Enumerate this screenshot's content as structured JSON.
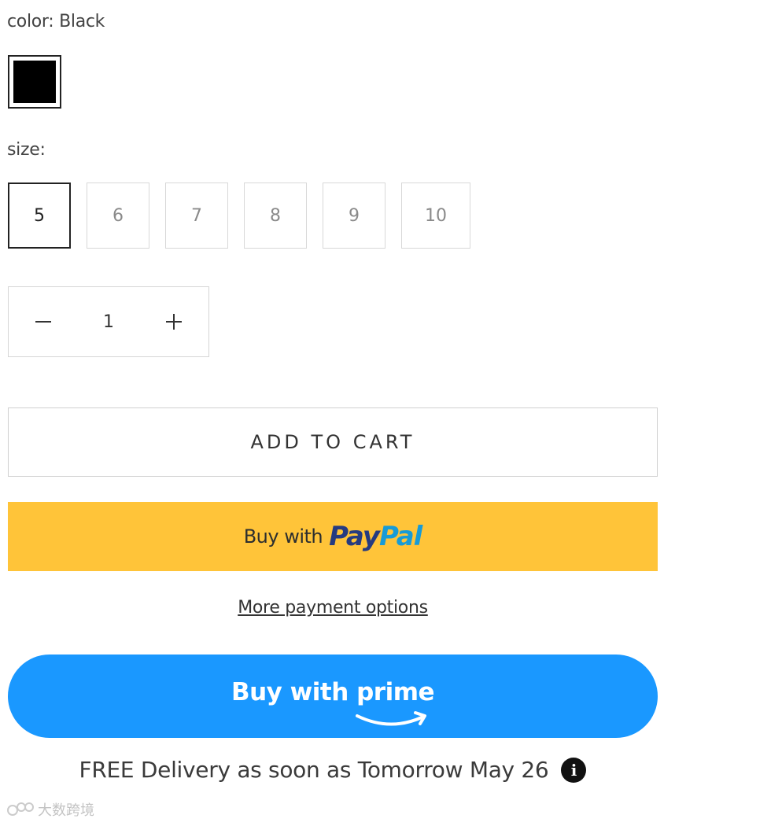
{
  "color": {
    "label": "color: Black",
    "swatch_color": "#000000"
  },
  "size": {
    "label": "size:",
    "options": [
      "5",
      "6",
      "7",
      "8",
      "9",
      "10"
    ],
    "selected": "5"
  },
  "quantity": {
    "value": "1",
    "minus_icon": "minus-icon",
    "plus_icon": "plus-icon"
  },
  "buttons": {
    "add_to_cart": "ADD TO CART",
    "paypal_buy": "Buy with",
    "paypal_brand_pay": "Pay",
    "paypal_brand_pal": "Pal",
    "more_payment": "More payment options",
    "prime": "Buy with prime"
  },
  "delivery": {
    "text": "FREE Delivery as soon as Tomorrow May 26",
    "icon": "info-icon"
  },
  "watermark": {
    "text": "大数跨境"
  },
  "colors": {
    "paypal_bg": "#FFC439",
    "paypal_dark": "#253B80",
    "paypal_light": "#179BD7",
    "prime_bg": "#1A98FF"
  }
}
